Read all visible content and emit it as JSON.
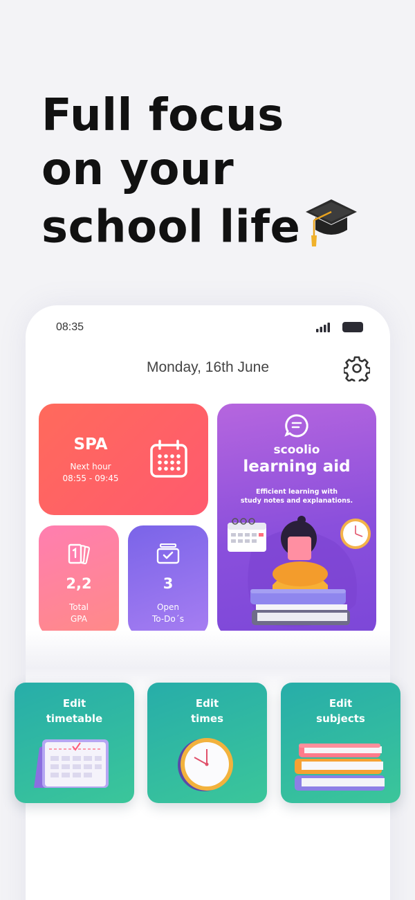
{
  "headline": {
    "line1": "Full focus",
    "line2": "on your",
    "line3": "school life",
    "emoji_icon": "graduation-cap-icon"
  },
  "status_bar": {
    "time": "08:35",
    "signal_icon": "signal-icon",
    "battery_icon": "battery-icon"
  },
  "header": {
    "date": "Monday, 16th June",
    "settings_icon": "gear-icon"
  },
  "next_lesson": {
    "subject": "SPA",
    "label": "Next hour",
    "time_range": "08:55 - 09:45",
    "icon": "calendar-icon",
    "color_from": "#ff6a5c",
    "color_to": "#ff5a6e"
  },
  "gpa": {
    "value": "2,2",
    "label1": "Total",
    "label2": "GPA",
    "icon": "cards-icon"
  },
  "todos": {
    "value": "3",
    "label1": "Open",
    "label2": "To-Do´s",
    "icon": "checkbox-tray-icon"
  },
  "learning_aid": {
    "brand": "scoolio",
    "title": "learning aid",
    "desc_line1": "Efficient learning with",
    "desc_line2": "study notes and explanations.",
    "icon": "chat-bubble-icon"
  },
  "tiles": [
    {
      "line1": "Edit",
      "line2": "timetable",
      "icon": "calendar-illustration-icon"
    },
    {
      "line1": "Edit",
      "line2": "times",
      "icon": "clock-illustration-icon"
    },
    {
      "line1": "Edit",
      "line2": "subjects",
      "icon": "books-illustration-icon"
    }
  ],
  "colors": {
    "tile": "#2fb6a3",
    "aid": "#8a4fdc",
    "todo": "#7a64e8",
    "gpa": "#ff7eb0"
  }
}
